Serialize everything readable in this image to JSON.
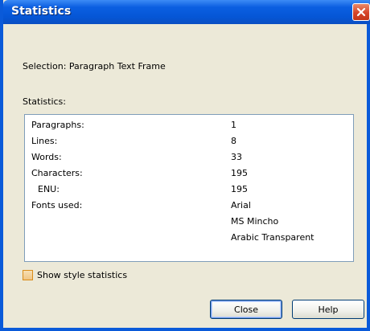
{
  "window": {
    "title": "Statistics"
  },
  "selection_text": "Selection: Paragraph Text Frame",
  "statistics_label": "Statistics:",
  "stats": [
    {
      "label": "Paragraphs:",
      "value": "1"
    },
    {
      "label": "Lines:",
      "value": "8"
    },
    {
      "label": "Words:",
      "value": "33"
    },
    {
      "label": "Characters:",
      "value": "195"
    },
    {
      "label": "ENU:",
      "value": "195"
    },
    {
      "label": "Fonts used:",
      "value": "Arial"
    },
    {
      "label": "",
      "value": "MS Mincho"
    },
    {
      "label": "",
      "value": "Arabic Transparent"
    }
  ],
  "checkbox": {
    "label": "Show style statistics",
    "checked": false
  },
  "buttons": {
    "close": "Close",
    "help": "Help"
  },
  "icons": {
    "close_window": "close-icon"
  },
  "colors": {
    "titlebar": "#0556d6",
    "close_button": "#d6442a",
    "dialog_bg": "#ece9d8",
    "checkbox_border": "#d98d1b"
  }
}
